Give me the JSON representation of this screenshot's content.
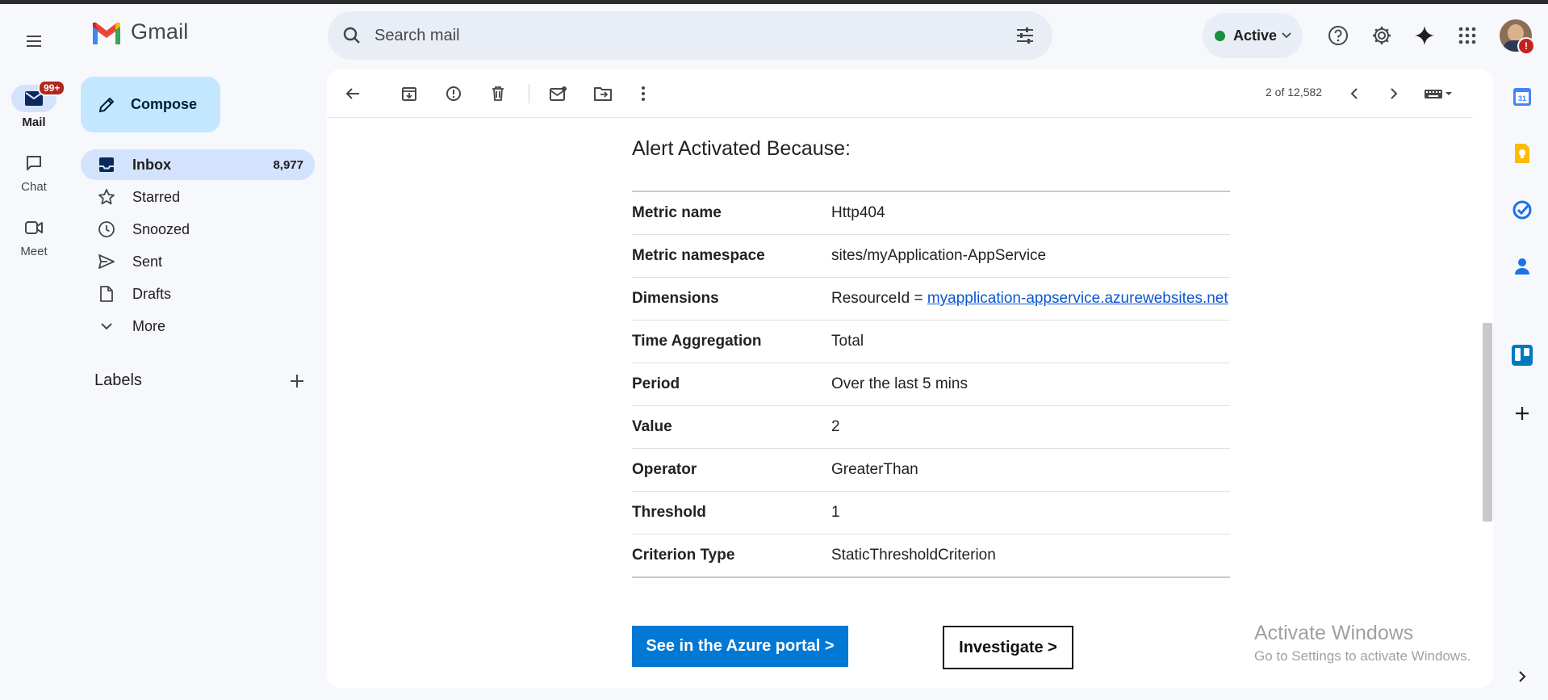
{
  "app": {
    "brand": "Gmail"
  },
  "rail": {
    "items": [
      {
        "label": "Mail",
        "badge": "99+"
      },
      {
        "label": "Chat"
      },
      {
        "label": "Meet"
      }
    ]
  },
  "search": {
    "placeholder": "Search mail"
  },
  "status": {
    "label": "Active",
    "color": "#1e8e3e"
  },
  "compose": {
    "label": "Compose"
  },
  "nav": {
    "items": [
      {
        "label": "Inbox",
        "count": "8,977"
      },
      {
        "label": "Starred"
      },
      {
        "label": "Snoozed"
      },
      {
        "label": "Sent"
      },
      {
        "label": "Drafts"
      },
      {
        "label": "More"
      }
    ]
  },
  "labels": {
    "title": "Labels"
  },
  "toolbar": {
    "pager": "2 of 12,582"
  },
  "email": {
    "heading": "Alert Activated Because:",
    "rows": [
      {
        "key": "Metric name",
        "value": "Http404"
      },
      {
        "key": "Metric namespace",
        "value": "sites/myApplication-AppService"
      },
      {
        "key": "Dimensions",
        "prefix": "ResourceId = ",
        "link": "myapplication-appservice.azurewebsites.net"
      },
      {
        "key": "Time Aggregation",
        "value": "Total"
      },
      {
        "key": "Period",
        "value": "Over the last 5 mins"
      },
      {
        "key": "Value",
        "value": "2"
      },
      {
        "key": "Operator",
        "value": "GreaterThan"
      },
      {
        "key": "Threshold",
        "value": "1"
      },
      {
        "key": "Criterion Type",
        "value": "StaticThresholdCriterion"
      }
    ],
    "azure_button": "See in the Azure portal >",
    "investigate_button": "Investigate >",
    "accent": "#0078d4"
  },
  "watermark": {
    "line1": "Activate Windows",
    "line2": "Go to Settings to activate Windows."
  },
  "icons": {
    "top_right": [
      "help-icon",
      "settings-icon",
      "gemini-icon",
      "apps-icon"
    ],
    "side_apps": [
      "calendar-icon",
      "keep-icon",
      "tasks-icon",
      "contacts-icon",
      "trello-icon",
      "add-icon"
    ]
  }
}
